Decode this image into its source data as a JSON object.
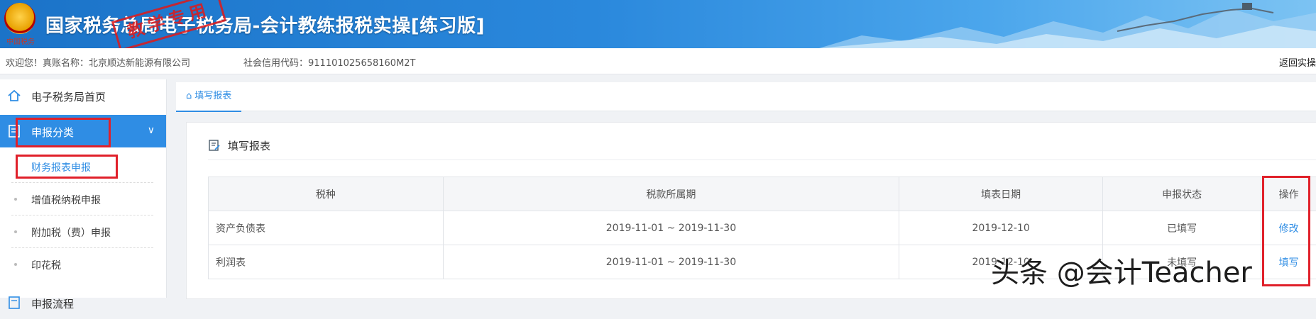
{
  "header": {
    "title": "国家税务总局电子税务局-会计教练报税实操[练习版]",
    "emblem_text": "中国税务",
    "stamp_text": "教学专用"
  },
  "topbar": {
    "welcome": "欢迎您！真账名称：北京顺达新能源有限公司",
    "credit_code": "社会信用代码：911101025658160M2T",
    "return_link": "返回实操"
  },
  "sidebar": {
    "home": "电子税务局首页",
    "category": "申报分类",
    "sub_items": [
      "财务报表申报",
      "增值税纳税申报",
      "附加税（费）申报",
      "印花税"
    ],
    "flow": "申报流程"
  },
  "tabs": {
    "active": "填写报表"
  },
  "panel": {
    "title": "填写报表",
    "columns": [
      "税种",
      "税款所属期",
      "填表日期",
      "申报状态",
      "操作"
    ],
    "rows": [
      {
        "tax": "资产负债表",
        "period": "2019-11-01 ~ 2019-11-30",
        "date": "2019-12-10",
        "status": "已填写",
        "action": "修改"
      },
      {
        "tax": "利润表",
        "period": "2019-11-01 ~ 2019-11-30",
        "date": "2019-12-10",
        "status": "未填写",
        "action": "填写"
      }
    ]
  },
  "watermark": "头条 @会计Teacher",
  "colors": {
    "accent": "#2f8de4",
    "highlight": "#e0202a",
    "header": "#1b73c8"
  }
}
